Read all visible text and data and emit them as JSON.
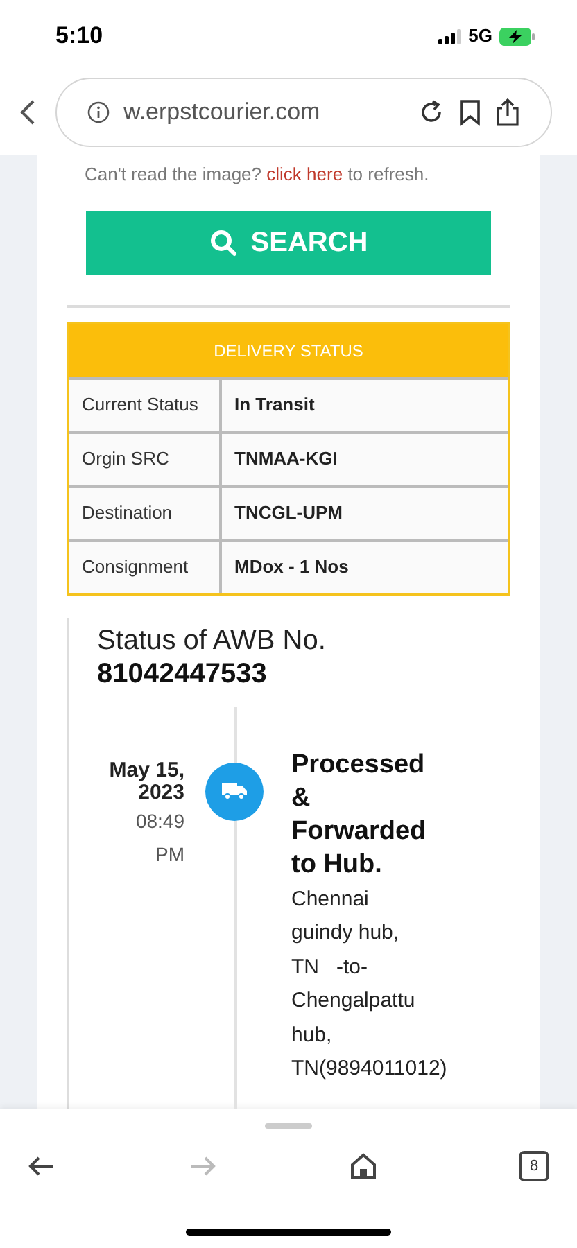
{
  "status_bar": {
    "time": "5:10",
    "network": "5G"
  },
  "address_bar": {
    "url": "w.erpstcourier.com"
  },
  "captcha_hint": {
    "before": "Can't read the image?",
    "link": "click here",
    "after": "to refresh."
  },
  "search_button": {
    "label": "SEARCH"
  },
  "delivery_status": {
    "title": "DELIVERY STATUS",
    "rows": [
      {
        "label": "Current Status",
        "value": "In Transit"
      },
      {
        "label": "Orgin SRC",
        "value": "TNMAA-KGI"
      },
      {
        "label": "Destination",
        "value": "TNCGL-UPM"
      },
      {
        "label": "Consignment",
        "value": "MDox - 1 Nos"
      }
    ]
  },
  "tracking": {
    "heading": "Status of AWB No.",
    "awb": "81042447533",
    "events": [
      {
        "date_lines": [
          "May 15,",
          "2023"
        ],
        "time_lines": [
          "08:49",
          "PM"
        ],
        "title_lines": [
          "Processed",
          "&",
          "Forwarded",
          "to Hub."
        ],
        "detail_lines": [
          "Chennai",
          "guindy hub,",
          "TN   -to-",
          "Chengalpattu",
          "hub,",
          "TN(9894011012)"
        ]
      }
    ]
  },
  "bottom_toolbar": {
    "back_enabled": true,
    "forward_enabled": false,
    "tab_count": "8"
  }
}
